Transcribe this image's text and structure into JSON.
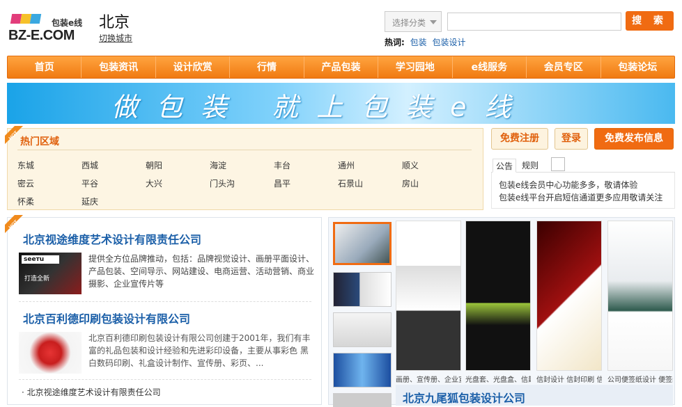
{
  "header": {
    "logo_cn": "包装e线",
    "logo_en": "BZ-E.COM",
    "city": "北京",
    "switch_city": "切换城市"
  },
  "search": {
    "category_label": "选择分类",
    "query_value": "",
    "button_label": "搜 索"
  },
  "hotwords": {
    "label": "热词:",
    "items": [
      "包装",
      "包装设计"
    ]
  },
  "nav": [
    "首页",
    "包装资讯",
    "设计欣赏",
    "行情",
    "产品包装",
    "学习园地",
    "e线服务",
    "会员专区",
    "包装论坛"
  ],
  "banner": "做包装 就上包装e线",
  "hot_area": {
    "title": "热门区域",
    "ribbon": "HOT",
    "districts": [
      "东城",
      "西城",
      "朝阳",
      "海淀",
      "丰台",
      "通州",
      "顺义",
      "密云",
      "平谷",
      "大兴",
      "门头沟",
      "昌平",
      "石景山",
      "房山",
      "怀柔",
      "延庆"
    ]
  },
  "actions": {
    "register": "免费注册",
    "login": "登录",
    "publish": "免费发布信息"
  },
  "notice": {
    "tabs": [
      "公告",
      "规则"
    ],
    "lines": [
      "包装e线会员中心功能多多，敬请体验",
      "包装e线平台开启短信通道更多应用敬请关注"
    ]
  },
  "listing": {
    "ribbon": "HOT",
    "companies": [
      {
        "name": "北京视途维度艺术设计有限责任公司",
        "thumb_brand": "seeтu",
        "thumb_slogan": "打造全新",
        "desc": "提供全方位品牌推动，包括：品牌视觉设计、画册平面设计、产品包装、空间导示、网站建设、电商运营、活动营销、商业摄影、企业宣传片等"
      },
      {
        "name": "北京百利德印刷包装设计有限公司",
        "desc": "北京百利德印刷包装设计有限公司创建于2001年，我们有丰富的礼品包装和设计经验和先进彩印设备，主要从事彩色 黑白数码印刷、礼盒设计制作、宣传册、彩页、..."
      }
    ],
    "more": "· 北京视途维度艺术设计有限责任公司"
  },
  "gallery": {
    "captions": [
      "画册、宣传册、企业宣传册",
      "光盘套、光盘盒、信封设计",
      "信封设计 信封印刷 信封制",
      "公司便签纸设计 便签纸设计"
    ],
    "title": "北京九尾狐包装设计公司"
  },
  "colors": {
    "accent": "#f06b12",
    "link": "#1b5fa8",
    "area_bg": "#fdf5e3"
  }
}
